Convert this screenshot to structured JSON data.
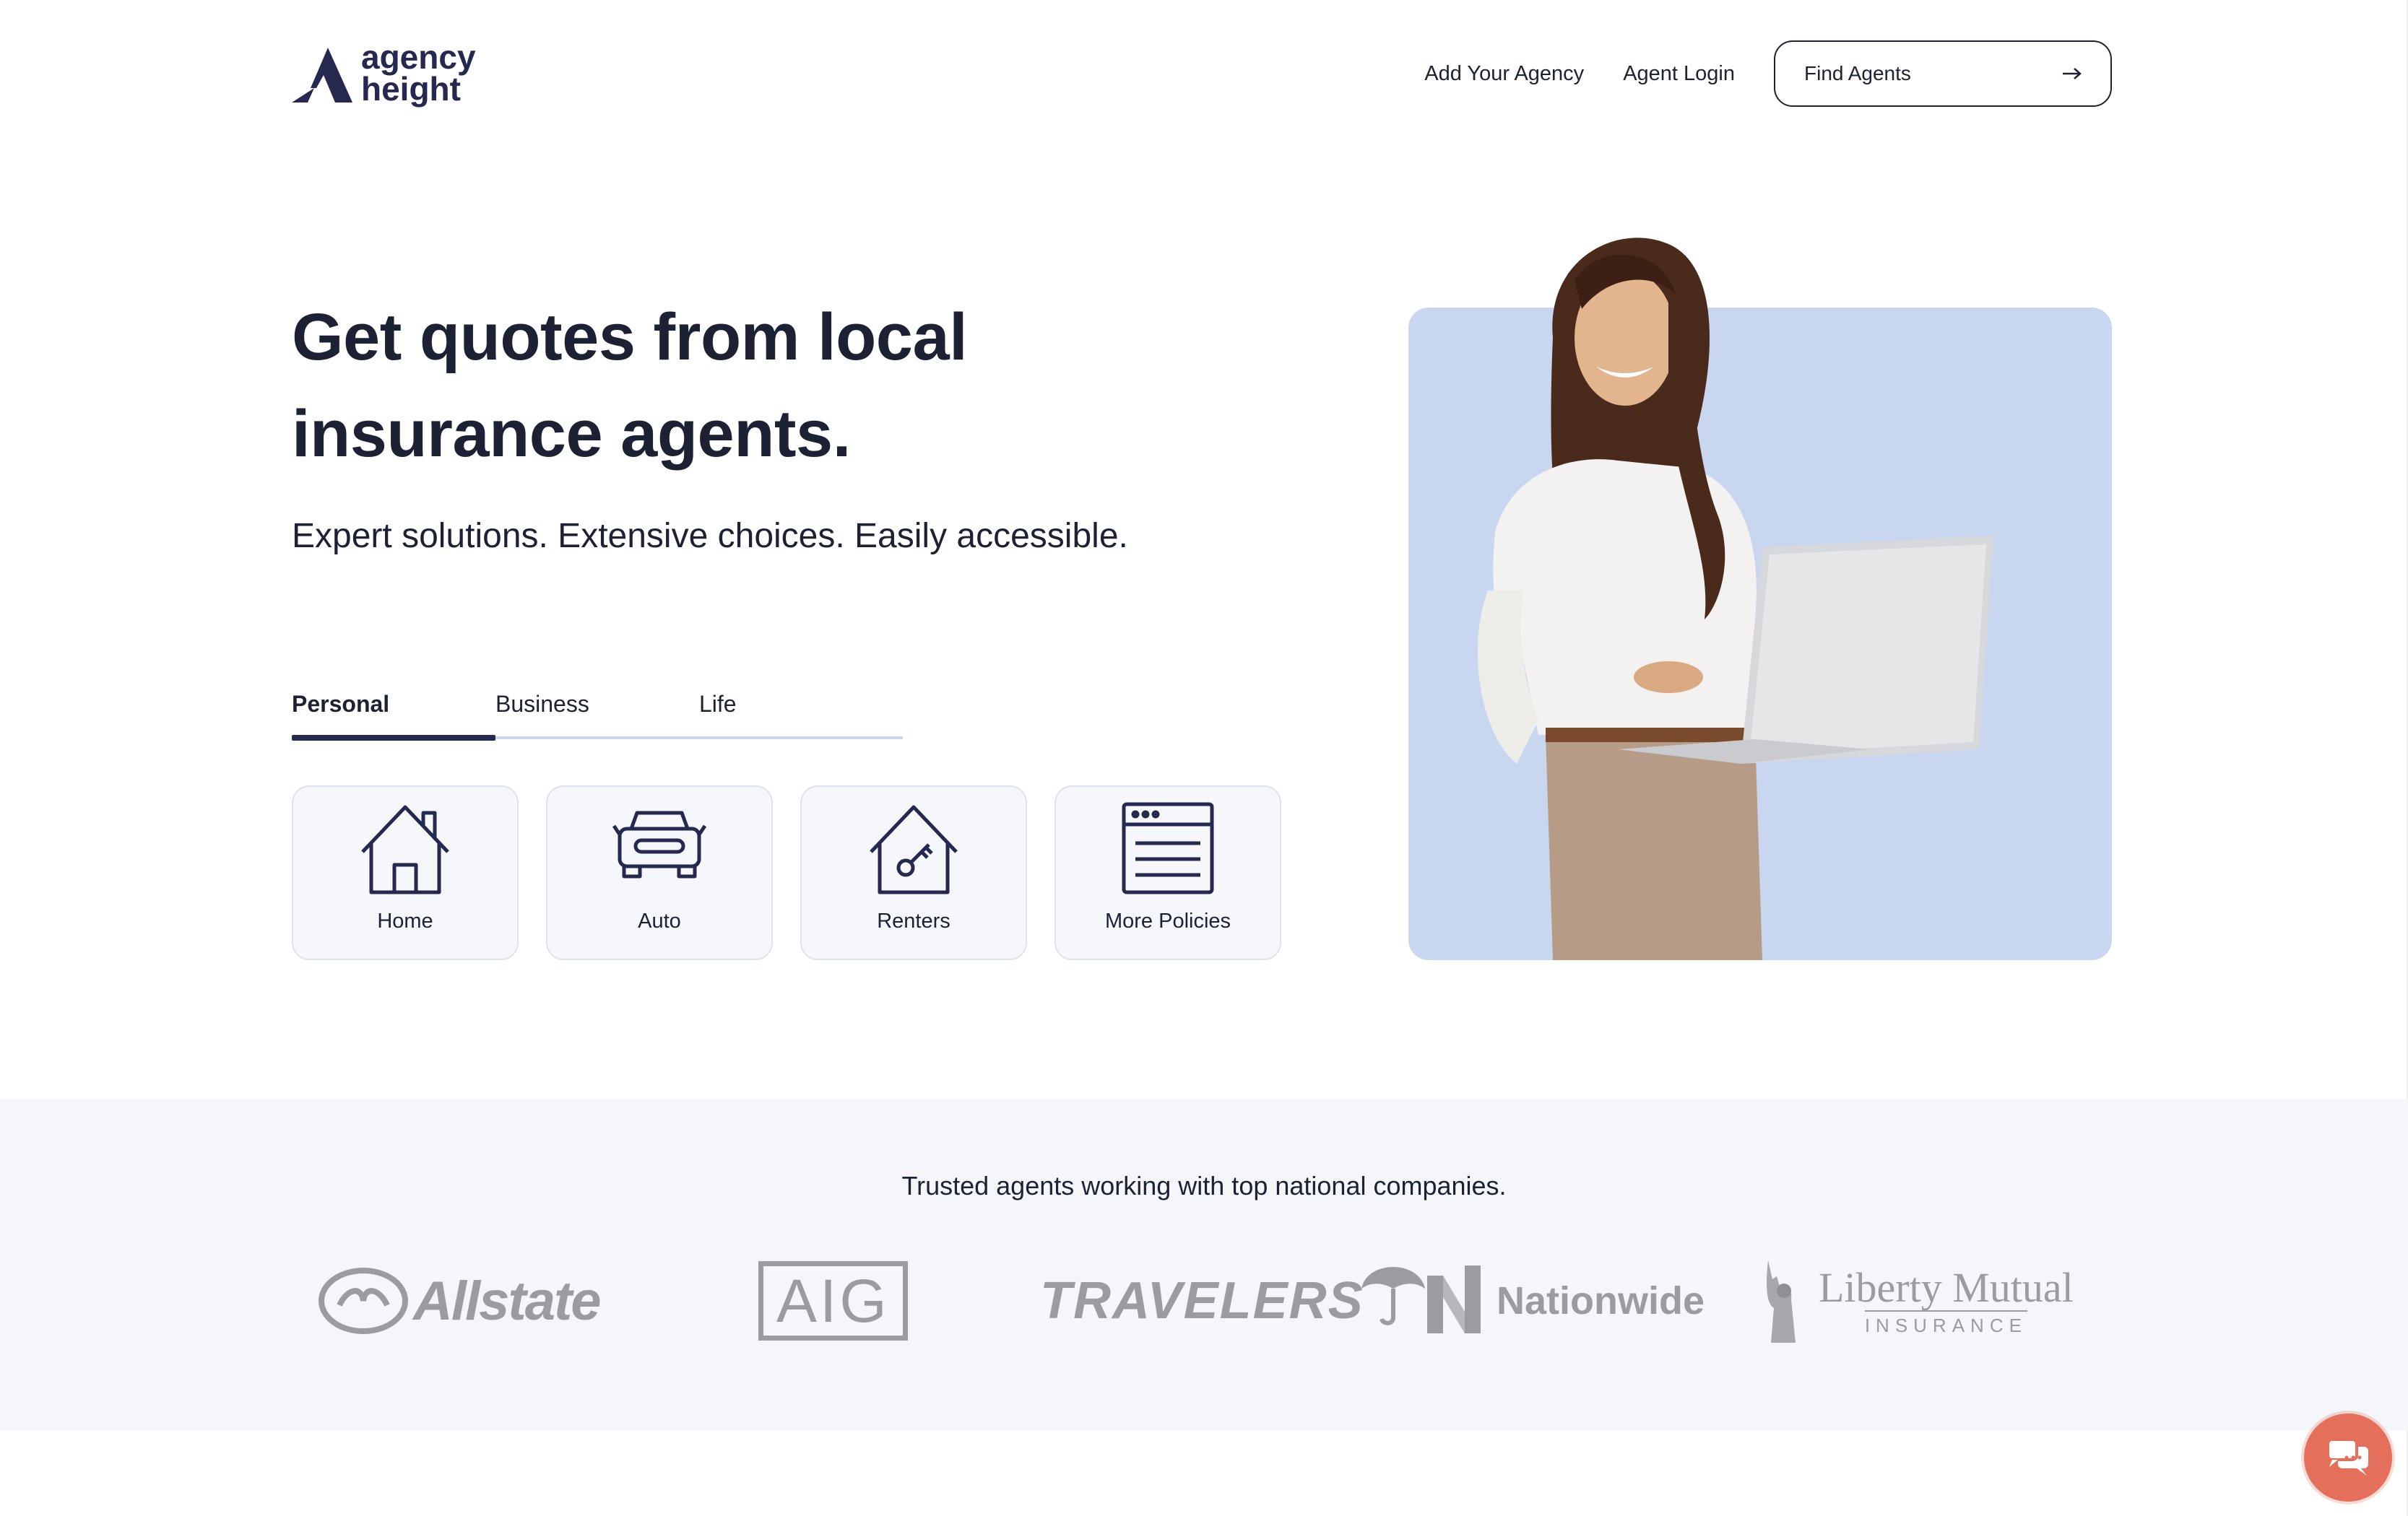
{
  "brand": {
    "name_line1": "agency",
    "name_line2": "height",
    "color": "#25284f"
  },
  "nav": {
    "links": [
      "Add Your Agency",
      "Agent Login"
    ],
    "cta_label": "Find Agents",
    "cta_icon": "arrow-right-icon"
  },
  "hero": {
    "headline": "Get quotes from local insurance agents.",
    "subheadline": "Expert solutions. Extensive choices. Easily accessible.",
    "tabs": [
      {
        "label": "Personal",
        "active": true
      },
      {
        "label": "Business",
        "active": false
      },
      {
        "label": "Life",
        "active": false
      }
    ],
    "cards": [
      {
        "label": "Home",
        "icon": "house-icon"
      },
      {
        "label": "Auto",
        "icon": "car-icon"
      },
      {
        "label": "Renters",
        "icon": "house-key-icon"
      },
      {
        "label": "More Policies",
        "icon": "document-list-icon"
      }
    ],
    "image_bg": "#c9d6f0"
  },
  "trust": {
    "text": "Trusted agents working with top national companies.",
    "partners": [
      "Allstate",
      "AIG",
      "TRAVELERS",
      "Nationwide",
      "Liberty Mutual",
      "INSURANCE"
    ]
  },
  "chat": {
    "icon": "chat-bubbles-icon",
    "color": "#e46f5b"
  }
}
